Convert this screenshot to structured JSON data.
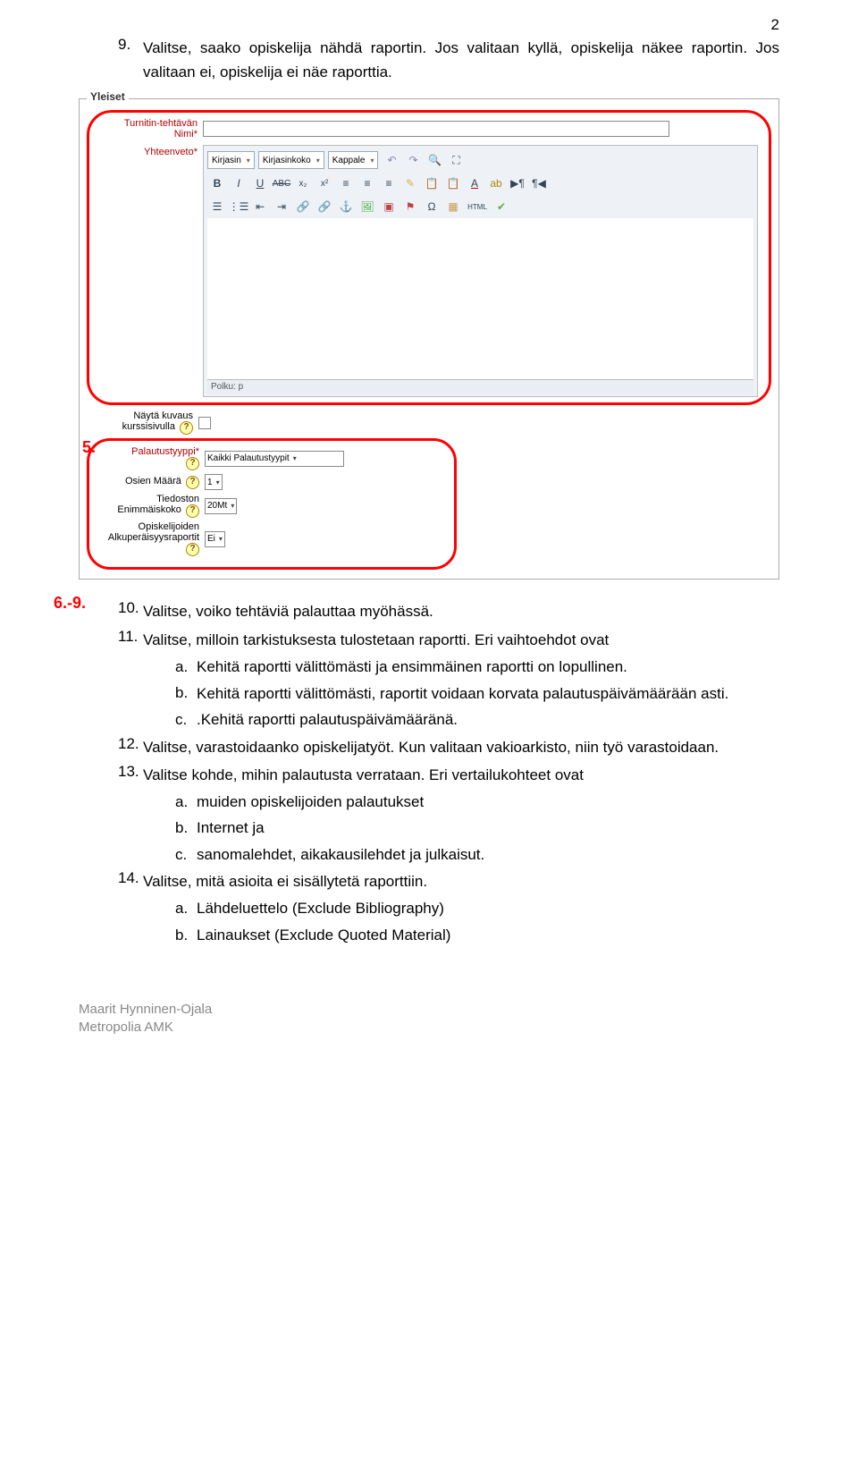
{
  "page_number": "2",
  "item9": {
    "num": "9.",
    "text": "Valitse, saako opiskelija nähdä raportin. Jos valitaan kyllä, opiskelija näkee raportin. Jos valitaan ei, opiskelija ei näe raporttia."
  },
  "annot5": "5.",
  "annot69": "6.-9.",
  "editor": {
    "fieldset": "Yleiset",
    "label_nimi_1": "Turnitin-tehtävän",
    "label_nimi_2": "Nimi*",
    "label_yht": "Yhteenveto*",
    "sel_font": "Kirjasin",
    "sel_size": "Kirjasinkoko",
    "sel_para": "Kappale",
    "path": "Polku: p",
    "row_nayta_1": "Näytä kuvaus",
    "row_nayta_2": "kurssisivulla",
    "row_pal": "Palautustyyppi*",
    "val_pal": "Kaikki Palautustyypit",
    "row_osien": "Osien Määrä",
    "val_osien": "1",
    "row_tied": "Tiedoston",
    "row_tied_2": "Enimmäiskoko",
    "val_tied": "20Mt",
    "row_opisk_1": "Opiskelijoiden",
    "row_opisk_2": "Alkuperäisyysraportit",
    "val_opisk": "Ei",
    "html_tag": "HTML"
  },
  "items": {
    "i10": {
      "num": "10.",
      "text": "Valitse, voiko tehtäviä palauttaa myöhässä."
    },
    "i11": {
      "num": "11.",
      "text": "Valitse, milloin tarkistuksesta tulostetaan raportti. Eri vaihtoehdot ovat",
      "a": {
        "m": "a.",
        "t": "Kehitä raportti välittömästi ja ensimmäinen raportti on lopullinen."
      },
      "b": {
        "m": "b.",
        "t": "Kehitä raportti välittömästi, raportit voidaan korvata palautuspäivämäärään asti."
      },
      "c": {
        "m": "c.",
        "t": ".Kehitä raportti palautuspäivämääränä."
      }
    },
    "i12": {
      "num": "12.",
      "text": "Valitse, varastoidaanko opiskelijatyöt. Kun valitaan vakioarkisto, niin työ varastoidaan."
    },
    "i13": {
      "num": "13.",
      "text": "Valitse kohde, mihin palautusta verrataan. Eri vertailukohteet ovat",
      "a": {
        "m": "a.",
        "t": "muiden opiskelijoiden palautukset"
      },
      "b": {
        "m": "b.",
        "t": "Internet ja"
      },
      "c": {
        "m": "c.",
        "t": "sanomalehdet, aikakausilehdet ja julkaisut."
      }
    },
    "i14": {
      "num": "14.",
      "text": "Valitse, mitä asioita ei sisällytetä raporttiin.",
      "a": {
        "m": "a.",
        "t": "Lähdeluettelo (Exclude Bibliography)"
      },
      "b": {
        "m": "b.",
        "t": "Lainaukset (Exclude Quoted Material)"
      }
    }
  },
  "footer": {
    "line1": "Maarit Hynninen-Ojala",
    "line2": "Metropolia AMK"
  }
}
